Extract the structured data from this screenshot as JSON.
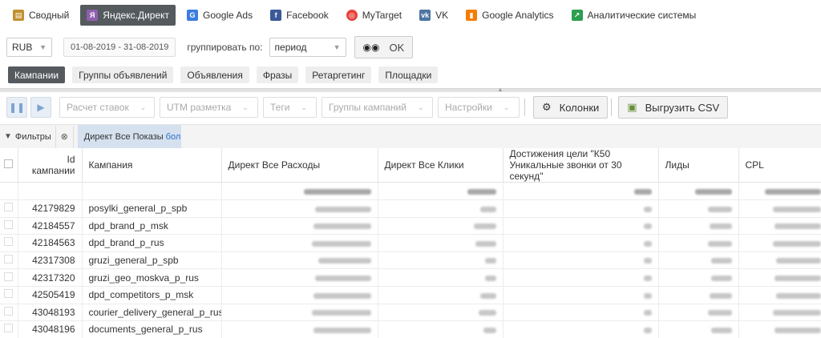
{
  "nav": {
    "items": [
      {
        "label": "Сводный",
        "icon": "summary-icon",
        "active": false
      },
      {
        "label": "Яндекс.Директ",
        "icon": "yandex-direct-icon",
        "active": true
      },
      {
        "label": "Google Ads",
        "icon": "google-ads-icon",
        "active": false
      },
      {
        "label": "Facebook",
        "icon": "facebook-icon",
        "active": false
      },
      {
        "label": "MyTarget",
        "icon": "mytarget-icon",
        "active": false
      },
      {
        "label": "VK",
        "icon": "vk-icon",
        "active": false
      },
      {
        "label": "Google Analytics",
        "icon": "google-analytics-icon",
        "active": false
      },
      {
        "label": "Аналитические системы",
        "icon": "analytics-systems-icon",
        "active": false
      }
    ]
  },
  "controls": {
    "currency": "RUB",
    "date_range": "01-08-2019 - 31-08-2019",
    "group_label": "группировать по:",
    "group_value": "период",
    "ok_label": "OK"
  },
  "subtabs": [
    "Кампании",
    "Группы объявлений",
    "Объявления",
    "Фразы",
    "Ретаргетинг",
    "Площадки"
  ],
  "toolbar": {
    "rate_calc": "Расчет ставок",
    "utm": "UTM разметка",
    "tags": "Теги",
    "campaign_groups": "Группы кампаний",
    "settings": "Настройки",
    "columns": "Колонки",
    "export_csv": "Выгрузить CSV"
  },
  "filters": {
    "label": "Фильтры",
    "tag": "Директ Все Показы",
    "tag_more": "бол"
  },
  "table": {
    "columns": [
      "Id кампании",
      "Кампания",
      "Директ Все Расходы",
      "Директ Все Клики",
      "Достижения цели \"К50 Уникальные звонки от 30 секунд\"",
      "Лиды",
      "CPL"
    ],
    "rows": [
      {
        "id": "42179829",
        "name": "posylki_general_p_spb"
      },
      {
        "id": "42184557",
        "name": "dpd_brand_p_msk"
      },
      {
        "id": "42184563",
        "name": "dpd_brand_p_rus"
      },
      {
        "id": "42317308",
        "name": "gruzi_general_p_spb"
      },
      {
        "id": "42317320",
        "name": "gruzi_geo_moskva_p_rus"
      },
      {
        "id": "42505419",
        "name": "dpd_competitors_p_msk"
      },
      {
        "id": "43048193",
        "name": "courier_delivery_general_p_rus"
      },
      {
        "id": "43048196",
        "name": "documents_general_p_rus"
      }
    ]
  },
  "colors": {
    "active_tab": "#555a5f",
    "filter_tag_bg": "#d5e1ef",
    "link": "#2a6fc9"
  }
}
